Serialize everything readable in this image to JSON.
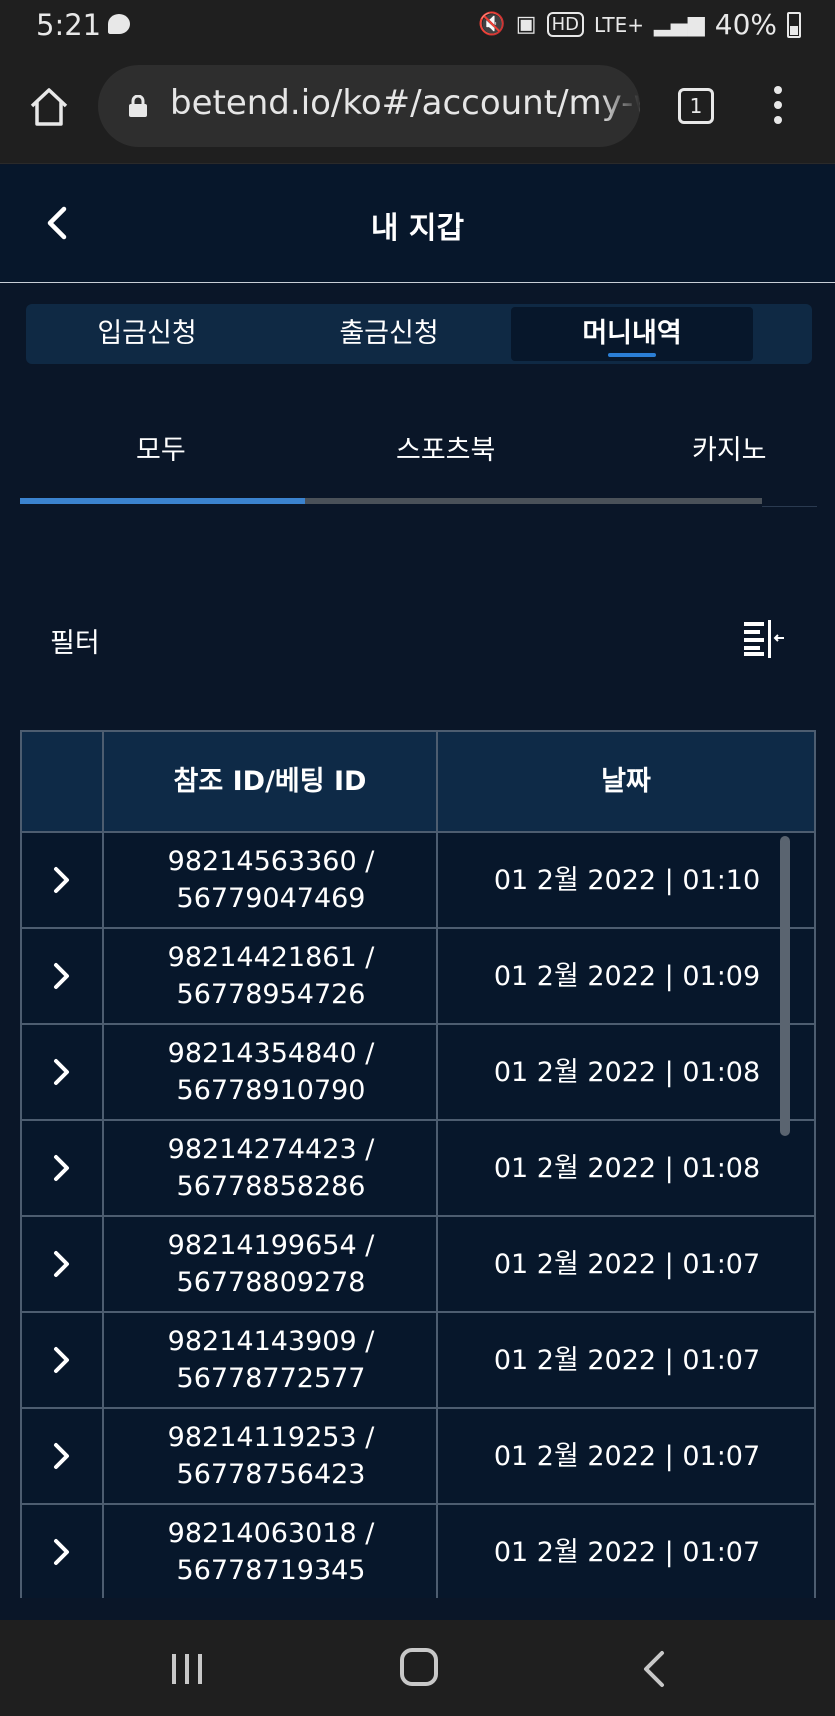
{
  "status_bar": {
    "time": "5:21",
    "network": "LTE+",
    "hd": "HD",
    "battery": "40%",
    "icons": [
      "chat-bubble-icon",
      "mute-icon",
      "save-icon",
      "hd-icon",
      "signal-icon",
      "battery-icon"
    ]
  },
  "browser": {
    "url": "betend.io/ko#/account/my-w",
    "tab_count": "1",
    "icons": [
      "home-icon",
      "lock-icon",
      "menu-dots-icon"
    ]
  },
  "header": {
    "title": "내 지갑"
  },
  "main_tabs": [
    {
      "label": "입금신청",
      "active": false
    },
    {
      "label": "출금신청",
      "active": false
    },
    {
      "label": "머니내역",
      "active": true
    }
  ],
  "sub_tabs": [
    {
      "label": "모두",
      "active": true
    },
    {
      "label": "스포츠북",
      "active": false
    },
    {
      "label": "카지노",
      "active": false
    }
  ],
  "filter": {
    "label": "필터"
  },
  "table": {
    "columns": [
      "",
      "참조 ID/베팅 ID",
      "날짜"
    ],
    "rows": [
      {
        "ref_line1": "98214563360 /",
        "ref_line2": "56779047469",
        "date": "01 2월 2022 | 01:10"
      },
      {
        "ref_line1": "98214421861 /",
        "ref_line2": "56778954726",
        "date": "01 2월 2022 | 01:09"
      },
      {
        "ref_line1": "98214354840 /",
        "ref_line2": "56778910790",
        "date": "01 2월 2022 | 01:08"
      },
      {
        "ref_line1": "98214274423 /",
        "ref_line2": "56778858286",
        "date": "01 2월 2022 | 01:08"
      },
      {
        "ref_line1": "98214199654 /",
        "ref_line2": "56778809278",
        "date": "01 2월 2022 | 01:07"
      },
      {
        "ref_line1": "98214143909 /",
        "ref_line2": "56778772577",
        "date": "01 2월 2022 | 01:07"
      },
      {
        "ref_line1": "98214119253 /",
        "ref_line2": "56778756423",
        "date": "01 2월 2022 | 01:07"
      },
      {
        "ref_line1": "98214063018 /",
        "ref_line2": "56778719345",
        "date": "01 2월 2022 | 01:07"
      }
    ]
  },
  "colors": {
    "background": "#0a1628",
    "header_bg": "#07172b",
    "tab_bar_bg": "#0f2944",
    "accent": "#3b83cf",
    "table_header_bg": "#0e2a47",
    "grid_line": "#4d5d70"
  }
}
